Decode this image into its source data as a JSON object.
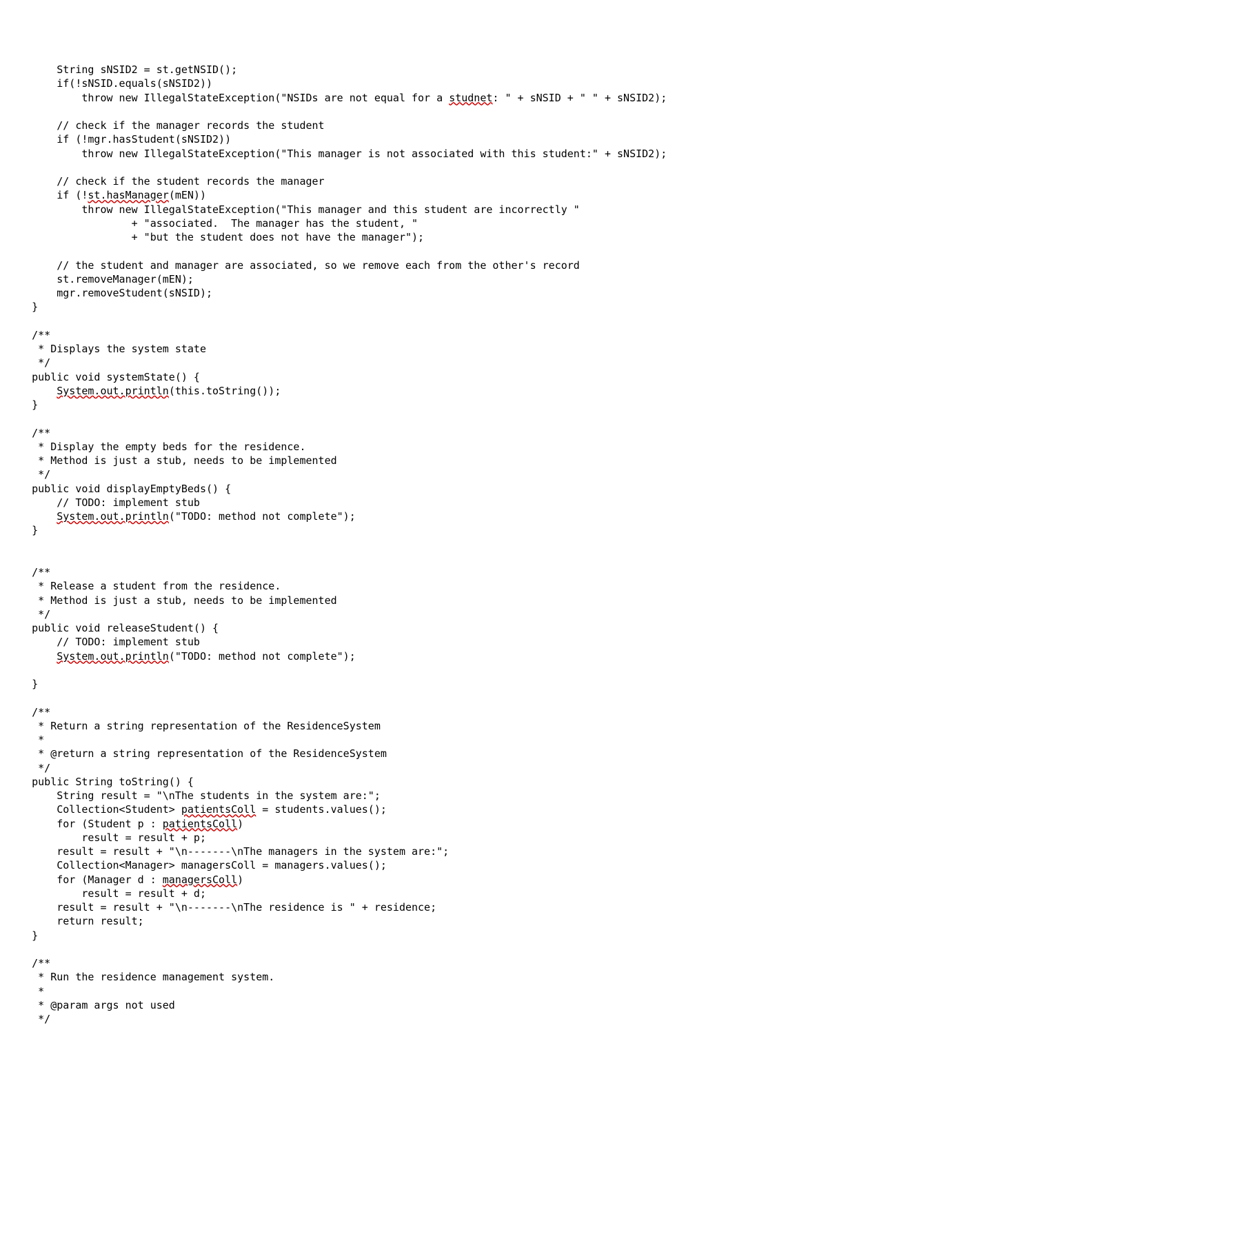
{
  "code_lines": [
    "        String sNSID2 = st.getNSID();",
    "        if(!sNSID.equals(sNSID2))",
    "            throw new IllegalStateException(\"NSIDs are not equal for a ~studnet~: \" + sNSID + \" \" + sNSID2);",
    "",
    "        // check if the manager records the student",
    "        if (!mgr.hasStudent(sNSID2))",
    "            throw new IllegalStateException(\"This manager is not associated with this student:\" + sNSID2);",
    "",
    "        // check if the student records the manager",
    "        if (!~st.hasManager~(mEN))",
    "            throw new IllegalStateException(\"This manager and this student are incorrectly \"",
    "                    + \"associated.  The manager has the student, \"",
    "                    + \"but the student does not have the manager\");",
    "",
    "        // the student and manager are associated, so we remove each from the other's record",
    "        st.removeManager(mEN);",
    "        mgr.removeStudent(sNSID);",
    "    }",
    "",
    "    /**",
    "     * Displays the system state",
    "     */",
    "    public void systemState() {",
    "        ~System.out.println~(this.toString());",
    "    }",
    "",
    "    /**",
    "     * Display the empty beds for the residence.",
    "     * Method is just a stub, needs to be implemented",
    "     */",
    "    public void displayEmptyBeds() {",
    "        // TODO: implement stub",
    "        ~System.out.println~(\"TODO: method not complete\");",
    "    }",
    "",
    "",
    "    /**",
    "     * Release a student from the residence.",
    "     * Method is just a stub, needs to be implemented",
    "     */",
    "    public void releaseStudent() {",
    "        // TODO: implement stub",
    "        ~System.out.println~(\"TODO: method not complete\");",
    "",
    "    }",
    "",
    "    /**",
    "     * Return a string representation of the ResidenceSystem",
    "     * ",
    "     * @return a string representation of the ResidenceSystem",
    "     */",
    "    public String toString() {",
    "        String result = \"\\nThe students in the system are:\";",
    "        Collection<Student> ~patientsColl~ = students.values();",
    "        for (Student p : ~patientsColl~)",
    "            result = result + p;",
    "        result = result + \"\\n-------\\nThe managers in the system are:\";",
    "        Collection<Manager> managersColl = managers.values();",
    "        for (Manager d : ~managersColl~)",
    "            result = result + d;",
    "        result = result + \"\\n-------\\nThe residence is \" + residence;",
    "        return result;",
    "    }",
    "",
    "    /**",
    "     * Run the residence management system.",
    "     * ",
    "     * @param args not used",
    "     */"
  ]
}
